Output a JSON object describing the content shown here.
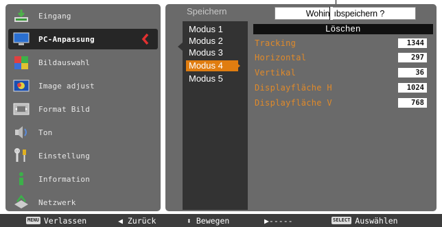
{
  "annotation": {
    "text_before": "Wohin ",
    "text_after": "ıbspeichern ?"
  },
  "sidebar": {
    "items": [
      {
        "label": "Eingang",
        "icon": "input-icon"
      },
      {
        "label": "PC-Anpassung",
        "icon": "monitor-icon",
        "active": true
      },
      {
        "label": "Bildauswahl",
        "icon": "image-select-icon"
      },
      {
        "label": "Image adjust",
        "icon": "image-adjust-icon"
      },
      {
        "label": "Format Bild",
        "icon": "screen-format-icon"
      },
      {
        "label": "Ton",
        "icon": "speaker-icon"
      },
      {
        "label": "Einstellung",
        "icon": "tools-icon"
      },
      {
        "label": "Information",
        "icon": "info-icon"
      },
      {
        "label": "Netzwerk",
        "icon": "network-icon"
      }
    ]
  },
  "main": {
    "title": "Speichern",
    "modes": [
      "Modus 1",
      "Modus 2",
      "Modus 3",
      "Modus 4",
      "Modus 5"
    ],
    "selected_mode": "Modus 4",
    "delete_label": "Löschen",
    "params": [
      {
        "label": "Tracking",
        "value": "1344"
      },
      {
        "label": "Horizontal",
        "value": "297"
      },
      {
        "label": "Vertikal",
        "value": "36"
      },
      {
        "label": "Displayfläche H",
        "value": "1024"
      },
      {
        "label": "Displayfläche V",
        "value": "768"
      }
    ]
  },
  "footer": {
    "menu_key": "MENU",
    "exit": "Verlassen",
    "back": "◀ Zurück",
    "move": "⬍ Bewegen",
    "next": "▶-----",
    "select_key": "SELECT",
    "select": "Auswählen"
  },
  "colors": {
    "panel": "#6a6a6a",
    "accent": "#e07d10",
    "active_chevron": "#e23030",
    "param_text": "#e08a2a"
  }
}
